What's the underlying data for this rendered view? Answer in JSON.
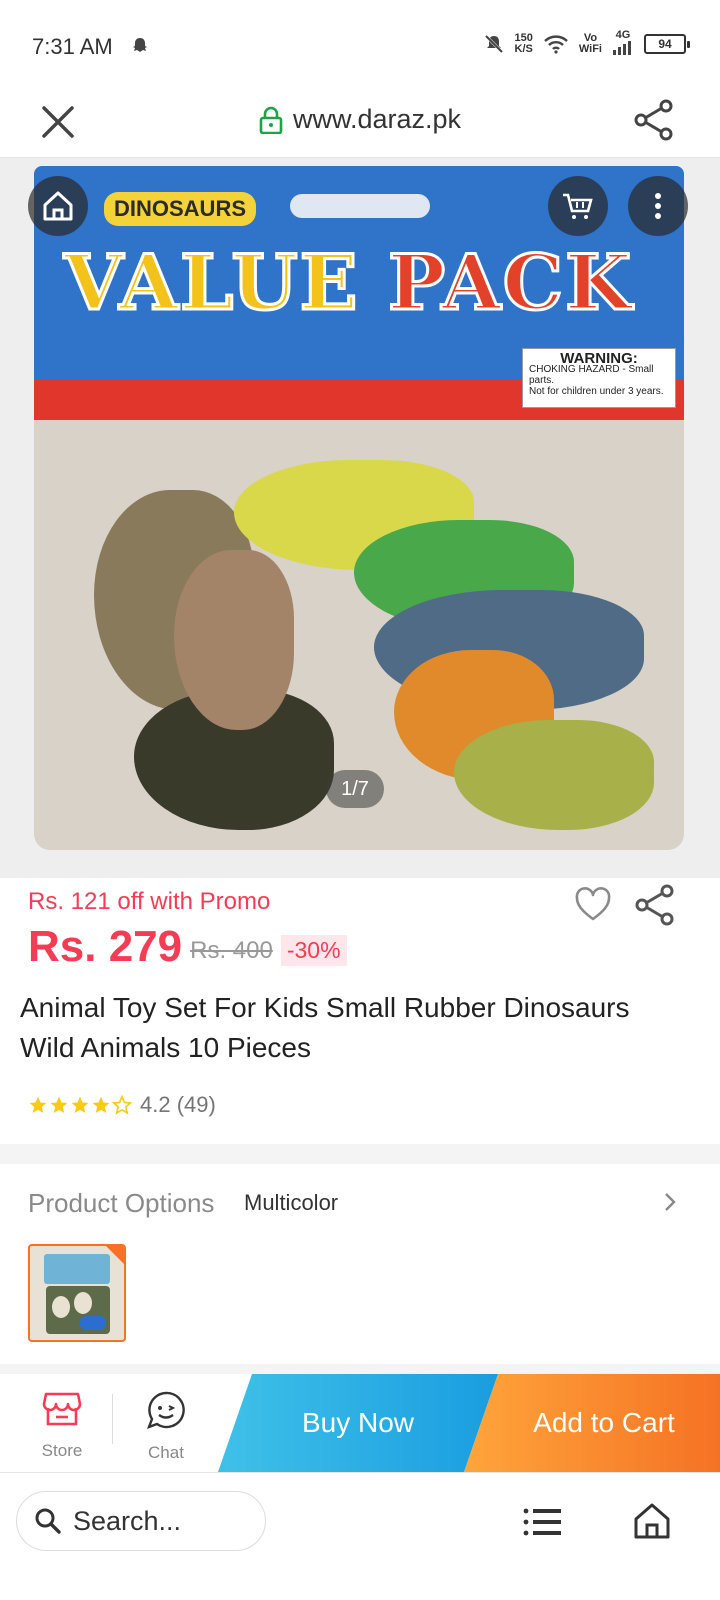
{
  "status_bar": {
    "time": "7:31 AM",
    "speed_value": "150",
    "speed_unit": "K/S",
    "network_top": "Vo",
    "network_bottom": "WiFi",
    "network_type": "4G",
    "battery": "94"
  },
  "url_bar": {
    "url": "www.daraz.pk"
  },
  "gallery": {
    "counter": "1/7",
    "package_brand": "DINOSAURS",
    "package_title_1": "VALUE",
    "package_title_2": "PACK",
    "warning_title": "WARNING:",
    "warning_text_1": "CHOKING HAZARD - Small parts.",
    "warning_text_2": "Not for children under 3 years."
  },
  "product": {
    "promo": "Rs. 121 off with Promo",
    "price": "Rs. 279",
    "old_price": "Rs. 400",
    "discount": "-30%",
    "title": "Animal Toy Set For Kids Small Rubber Dinosaurs Wild Animals 10 Pieces",
    "rating_value": 4.2,
    "rating_text": "4.2 (49)"
  },
  "options": {
    "label": "Product Options",
    "value": "Multicolor"
  },
  "actions": {
    "store_label": "Store",
    "chat_label": "Chat",
    "buy_now": "Buy Now",
    "add_to_cart": "Add to Cart"
  },
  "bottom_bar": {
    "search_placeholder": "Search..."
  },
  "colors": {
    "accent_red": "#f63b54",
    "orange": "#f57224",
    "blue": "#1a9de0"
  }
}
